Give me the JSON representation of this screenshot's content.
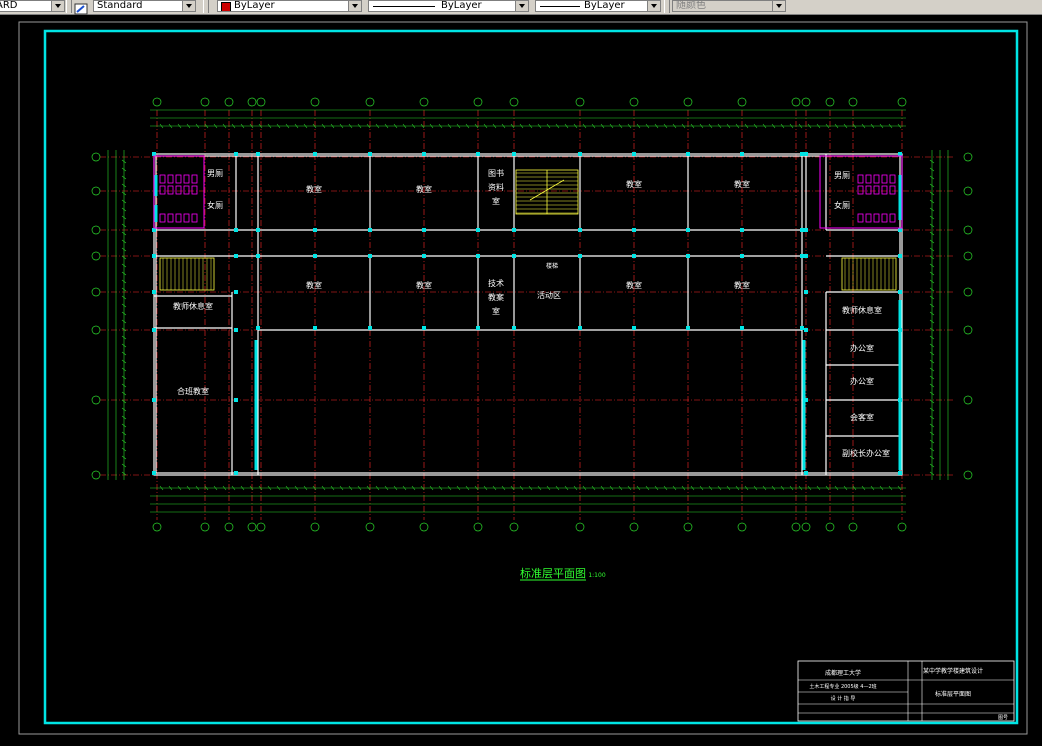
{
  "toolbar": {
    "dimstyle_value": "ARD",
    "textstyle_value": "Standard",
    "layer_color_value": "ByLayer",
    "layer_color_swatch": "#cc0000",
    "linetype_value": "ByLayer",
    "lineweight_value": "ByLayer",
    "plotstyle_value": "随颜色"
  },
  "drawing": {
    "title": "标准层平面图",
    "scale": "1:100",
    "rooms": {
      "classroom_1": "教室",
      "classroom_2": "教室",
      "classroom_3": "教室",
      "classroom_4": "教室",
      "classroom_5": "教室",
      "classroom_6": "教室",
      "classroom_7": "教室",
      "classroom_8": "教室",
      "library_1": "图书",
      "library_2": "资料",
      "library_3": "室",
      "prep_1": "技术",
      "prep_2": "教案",
      "prep_3": "室",
      "activity": "活动区",
      "activity_note": "楼梯",
      "toilet_men_left": "男厕",
      "toilet_women_left": "女厕",
      "toilet_men_right": "男厕",
      "toilet_women_right": "女厕",
      "teacher_rest_left": "教师休息室",
      "teacher_rest_right": "教师休息室",
      "tiered_classroom": "合班教室",
      "office_1": "办公室",
      "office_2": "办公室",
      "meeting": "会客室",
      "vp_office": "副校长办公室"
    },
    "title_block": {
      "school": "成都理工大学",
      "project": "某中学教学楼建筑设计",
      "sheet_name": "标准层平面图",
      "class_info": "土木工程专业 2005级 4—2班",
      "row3": "设 计  指 导",
      "row_bottom": "图号"
    }
  },
  "colors": {
    "background": "#000000",
    "frame": "#00e5e5",
    "wall": "#ffffff",
    "axis": "#ff2a2a",
    "dimension": "#2bd92b",
    "column": "#00e5e5",
    "stair": "#ffff40",
    "fixture": "#ff00ff",
    "text": "#ffffff",
    "title": "#30ff30"
  }
}
